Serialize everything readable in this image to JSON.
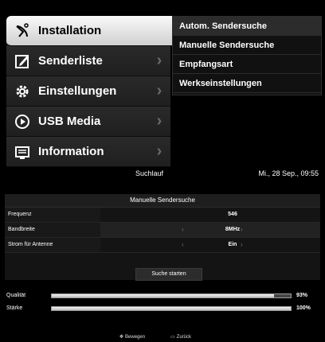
{
  "menu": {
    "items": [
      {
        "label": "Installation",
        "icon": "satellite-icon"
      },
      {
        "label": "Senderliste",
        "icon": "edit-icon"
      },
      {
        "label": "Einstellungen",
        "icon": "gear-icon"
      },
      {
        "label": "USB Media",
        "icon": "play-icon"
      },
      {
        "label": "Information",
        "icon": "info-screen-icon"
      }
    ],
    "submenu": [
      "Autom. Sendersuche",
      "Manuelle Sendersuche",
      "Empfangsart",
      "Werkseinstellungen"
    ]
  },
  "search": {
    "title": "Suchlauf",
    "datetime": "Mi., 28 Sep., 09:55",
    "panel_title": "Manuelle Sendersuche",
    "fields": [
      {
        "label": "Frequenz",
        "value": "546"
      },
      {
        "label": "Bandbreite",
        "value": "8MHz"
      },
      {
        "label": "Strom für Antenne",
        "value": "Ein"
      }
    ],
    "start_label": "Suche starten",
    "signals": [
      {
        "label": "Qualität",
        "percent": 93,
        "text": "93%"
      },
      {
        "label": "Stärke",
        "percent": 100,
        "text": "100%"
      }
    ],
    "footer": {
      "move": "Bewegen",
      "back": "Zurück"
    }
  },
  "colors": {
    "highlight": "#e8e8e8",
    "panel": "#1b1b1b",
    "background": "#000000"
  }
}
